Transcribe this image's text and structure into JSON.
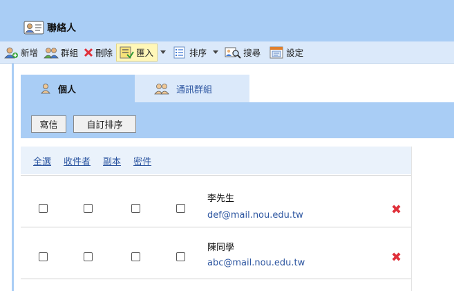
{
  "window": {
    "title": "聯絡人",
    "title_icon": "contact-card-icon"
  },
  "toolbar": {
    "items": [
      {
        "label": "新增",
        "icon": "add-person-icon"
      },
      {
        "label": "群組",
        "icon": "group-icon"
      },
      {
        "label": "刪除",
        "icon": "delete-x-icon"
      },
      {
        "label": "匯入",
        "icon": "import-icon"
      },
      {
        "label": "排序",
        "icon": "list-icon"
      },
      {
        "label": "搜尋",
        "icon": "search-icon"
      },
      {
        "label": "設定",
        "icon": "settings-icon"
      }
    ]
  },
  "tabs": [
    {
      "label": "個人",
      "icon": "person-icon",
      "active": true
    },
    {
      "label": "通訊群組",
      "icon": "group-icon",
      "active": false
    }
  ],
  "actions": {
    "send": "寫信",
    "custom_sort": "自訂排序"
  },
  "columns": {
    "select_all": "全選",
    "to": "收件者",
    "cc": "副本",
    "bcc": "密件"
  },
  "contacts": [
    {
      "name": "李先生",
      "email": "def@mail.nou.edu.tw"
    },
    {
      "name": "陳同學",
      "email": "abc@mail.nou.edu.tw"
    }
  ],
  "colors": {
    "title_bg": "#a9cdf5",
    "toolbar_bg": "#dbe9fa",
    "link": "#2c55a0",
    "delete": "#e0303a",
    "active_btn": "#fff7b8"
  }
}
